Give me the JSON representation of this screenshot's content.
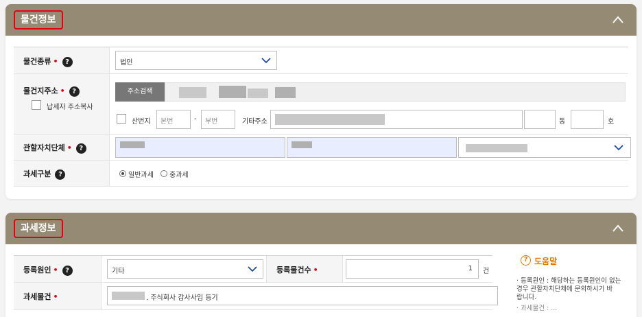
{
  "panel1": {
    "title": "물건정보",
    "rows": {
      "type": {
        "label": "물건종류",
        "value": "법인"
      },
      "address": {
        "label": "물건지주소",
        "copy_label": "납세자 주소복사",
        "search_button": "주소검색",
        "mountain_label": "산번지",
        "main_no_placeholder": "본번",
        "dash": "-",
        "sub_no_placeholder": "부번",
        "extra_label": "기타주소",
        "dong_label": "동",
        "ho_label": "호"
      },
      "municipality": {
        "label": "관할자치단체"
      },
      "taxclass": {
        "label": "과세구분",
        "opt1": "일반과세",
        "opt2": "중과세"
      }
    }
  },
  "panel2": {
    "title": "과세정보",
    "rows": {
      "reason": {
        "label": "등록원인",
        "value": "기타",
        "count_label": "등록물건수",
        "count_value": "1",
        "count_unit": "건"
      },
      "object": {
        "label": "과세물건",
        "value": ". 주식회사 감사사임 등기"
      }
    },
    "help": {
      "title": "도움말",
      "text1": "· 등록원인 : 해당하는 등록원인이 없는",
      "text2": "경우 관할자치단체에 문의하시기 바",
      "text3": "랍니다.",
      "text4": "· 과세물건 : ..."
    }
  },
  "colors": {
    "header": "#958a73",
    "highlight": "#e60012",
    "selected_bg": "#e8eeff"
  }
}
